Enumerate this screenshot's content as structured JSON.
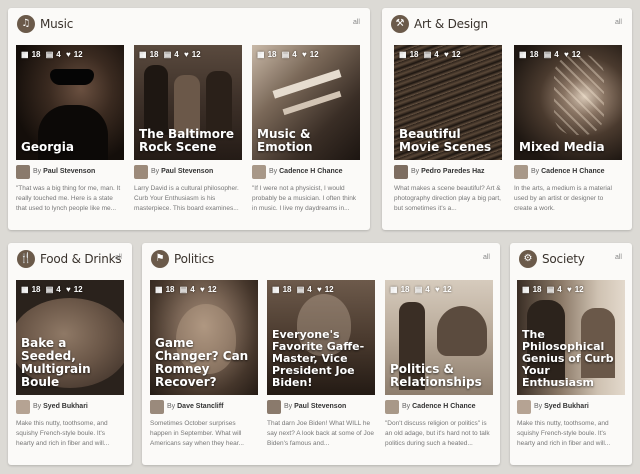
{
  "panels": [
    {
      "title": "Music",
      "all": "all",
      "icon": "music-note-icon",
      "glyph": "♫",
      "cards": [
        {
          "title": "Georgia",
          "grid": "18",
          "comments": "4",
          "likes": "12",
          "author": "Paul Stevenson",
          "by": "By",
          "excerpt": "\"That was a big thing for me, man. It really touched me. Here is a state that used to lynch people like me..."
        },
        {
          "title": "The Baltimore Rock Scene",
          "grid": "18",
          "comments": "4",
          "likes": "12",
          "author": "Paul Stevenson",
          "by": "By",
          "excerpt": "Larry David is a cultural philosopher. Curb Your Enthusiasm is his masterpiece. This board examines..."
        },
        {
          "title": "Music & Emotion",
          "grid": "18",
          "comments": "4",
          "likes": "12",
          "author": "Cadence H Chance",
          "by": "By",
          "excerpt": "\"If I were not a physicist, I would probably be a musician. I often think in music. I live my daydreams in..."
        }
      ]
    },
    {
      "title": "Art & Design",
      "all": "all",
      "icon": "hammer-icon",
      "glyph": "⚒",
      "cards": [
        {
          "title": "Beautiful Movie Scenes",
          "grid": "18",
          "comments": "4",
          "likes": "12",
          "author": "Pedro Paredes Haz",
          "by": "By",
          "excerpt": "What makes a scene beautiful? Art & photography direction play a big part, but sometimes it's a..."
        },
        {
          "title": "Mixed Media",
          "grid": "18",
          "comments": "4",
          "likes": "12",
          "author": "Cadence H Chance",
          "by": "By",
          "excerpt": "In the arts, a medium is a material used by an artist or designer to create a work."
        }
      ]
    },
    {
      "title": "Food & Drinks",
      "all": "all",
      "icon": "fork-knife-icon",
      "glyph": "🍴",
      "cards": [
        {
          "title": "Bake a Seeded, Multigrain Boule",
          "grid": "18",
          "comments": "4",
          "likes": "12",
          "author": "Syed Bukhari",
          "by": "By",
          "excerpt": "Make this nutty, toothsome, and squishy French-style boule. It's hearty and rich in fiber and will..."
        }
      ]
    },
    {
      "title": "Politics",
      "all": "all",
      "icon": "flag-icon",
      "glyph": "⚑",
      "cards": [
        {
          "title": "Game Changer? Can Romney Recover?",
          "grid": "18",
          "comments": "4",
          "likes": "12",
          "author": "Dave Stancliff",
          "by": "By",
          "excerpt": "Sometimes October surprises happen in September. What will Americans say when they hear..."
        },
        {
          "title": "Everyone's Favorite Gaffe-Master, Vice President Joe Biden!",
          "grid": "18",
          "comments": "4",
          "likes": "12",
          "author": "Paul Stevenson",
          "by": "By",
          "excerpt": "That darn Joe Biden! What WILL he say next? A look back at some of Joe Biden's famous and..."
        },
        {
          "title": "Politics & Relationships",
          "grid": "18",
          "comments": "4",
          "likes": "12",
          "author": "Cadence H Chance",
          "by": "By",
          "excerpt": "\"Don't discuss religion or politics\" is an old adage, but it's hard not to talk politics during such a heated..."
        }
      ]
    },
    {
      "title": "Society",
      "all": "all",
      "icon": "society-icon",
      "glyph": "⚙",
      "cards": [
        {
          "title": "The Philosophical Genius of Curb Your Enthusiasm",
          "grid": "18",
          "comments": "4",
          "likes": "12",
          "author": "Syed Bukhari",
          "by": "By",
          "excerpt": "Make this nutty, toothsome, and squishy French-style boule. It's hearty and rich in fiber and will..."
        }
      ]
    }
  ],
  "stat_icons": {
    "grid": "grid-icon",
    "comments": "comment-icon",
    "likes": "heart-icon"
  }
}
